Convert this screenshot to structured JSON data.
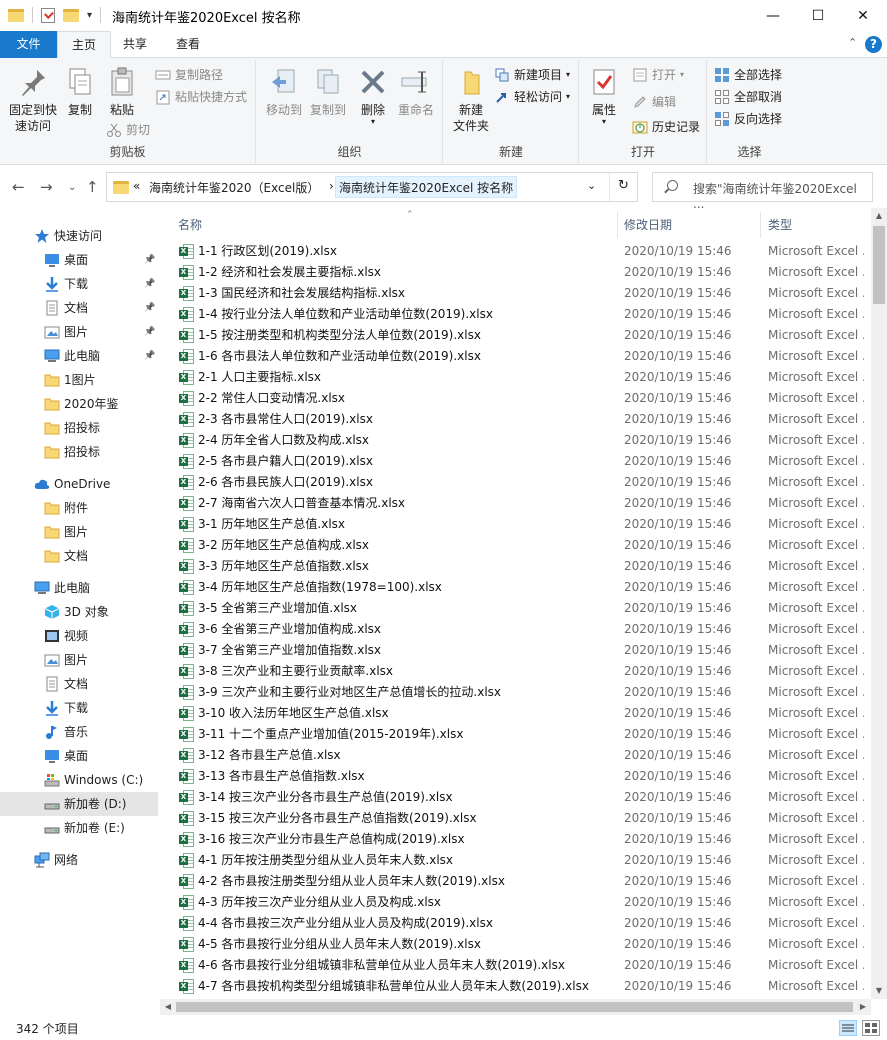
{
  "window": {
    "title": "海南统计年鉴2020Excel 按名称",
    "minimize": "—",
    "maximize": "☐",
    "close": "✕"
  },
  "ribbon_tabs": [
    {
      "label": "文件"
    },
    {
      "label": "主页"
    },
    {
      "label": "共享"
    },
    {
      "label": "查看"
    }
  ],
  "ribbon": {
    "clipboard": {
      "label": "剪贴板",
      "pin": "固定到快\n速访问",
      "copy": "复制",
      "paste": "粘贴",
      "copy_path": "复制路径",
      "paste_shortcut": "粘贴快捷方式",
      "cut": "剪切"
    },
    "organize": {
      "label": "组织",
      "move_to": "移动到",
      "copy_to": "复制到",
      "delete": "删除",
      "rename": "重命名"
    },
    "new": {
      "label": "新建",
      "new_folder": "新建\n文件夹",
      "new_item": "新建项目",
      "easy_access": "轻松访问"
    },
    "open": {
      "label": "打开",
      "properties": "属性",
      "open": "打开",
      "edit": "编辑",
      "history": "历史记录"
    },
    "select": {
      "label": "选择",
      "select_all": "全部选择",
      "select_none": "全部取消",
      "invert": "反向选择"
    }
  },
  "address": {
    "prefix": "«",
    "parent": "海南统计年鉴2020（Excel版）",
    "current": "海南统计年鉴2020Excel 按名称",
    "search_placeholder": "搜索\"海南统计年鉴2020Excel ..."
  },
  "sidebar": {
    "items": [
      {
        "label": "快速访问",
        "icon": "star-icon"
      },
      {
        "label": "桌面",
        "icon": "desktop-icon",
        "pinned": true
      },
      {
        "label": "下载",
        "icon": "download-icon",
        "pinned": true
      },
      {
        "label": "文档",
        "icon": "document-icon",
        "pinned": true
      },
      {
        "label": "图片",
        "icon": "pictures-icon",
        "pinned": true
      },
      {
        "label": "此电脑",
        "icon": "computer-icon",
        "pinned": true
      },
      {
        "label": "1图片",
        "icon": "folder-icon"
      },
      {
        "label": "2020年鉴",
        "icon": "folder-icon"
      },
      {
        "label": "招投标",
        "icon": "folder-icon"
      },
      {
        "label": "招投标",
        "icon": "folder-icon"
      },
      {
        "label": "OneDrive",
        "icon": "cloud-icon"
      },
      {
        "label": "附件",
        "icon": "folder-icon"
      },
      {
        "label": "图片",
        "icon": "folder-icon"
      },
      {
        "label": "文档",
        "icon": "folder-icon"
      },
      {
        "label": "此电脑",
        "icon": "computer-icon"
      },
      {
        "label": "3D 对象",
        "icon": "3d-objects-icon"
      },
      {
        "label": "视频",
        "icon": "video-icon"
      },
      {
        "label": "图片",
        "icon": "pictures-icon"
      },
      {
        "label": "文档",
        "icon": "document-icon"
      },
      {
        "label": "下载",
        "icon": "download-icon"
      },
      {
        "label": "音乐",
        "icon": "music-icon"
      },
      {
        "label": "桌面",
        "icon": "desktop-icon"
      },
      {
        "label": "Windows (C:)",
        "icon": "drive-c-icon"
      },
      {
        "label": "新加卷 (D:)",
        "icon": "drive-icon",
        "selected": true
      },
      {
        "label": "新加卷 (E:)",
        "icon": "drive-icon"
      },
      {
        "label": "网络",
        "icon": "network-icon"
      }
    ]
  },
  "columns": {
    "name": "名称",
    "date": "修改日期",
    "type": "类型"
  },
  "files": [
    {
      "name": "1-1 行政区划(2019).xlsx",
      "date": "2020/10/19 15:46",
      "type": "Microsoft Excel ..."
    },
    {
      "name": "1-2  经济和社会发展主要指标.xlsx",
      "date": "2020/10/19 15:46",
      "type": "Microsoft Excel ..."
    },
    {
      "name": "1-3  国民经济和社会发展结构指标.xlsx",
      "date": "2020/10/19 15:46",
      "type": "Microsoft Excel ..."
    },
    {
      "name": "1-4  按行业分法人单位数和产业活动单位数(2019).xlsx",
      "date": "2020/10/19 15:46",
      "type": "Microsoft Excel ..."
    },
    {
      "name": "1-5  按注册类型和机构类型分法人单位数(2019).xlsx",
      "date": "2020/10/19 15:46",
      "type": "Microsoft Excel ..."
    },
    {
      "name": "1-6  各市县法人单位数和产业活动单位数(2019).xlsx",
      "date": "2020/10/19 15:46",
      "type": "Microsoft Excel ..."
    },
    {
      "name": "2-1  人口主要指标.xlsx",
      "date": "2020/10/19 15:46",
      "type": "Microsoft Excel ..."
    },
    {
      "name": "2-2  常住人口变动情况.xlsx",
      "date": "2020/10/19 15:46",
      "type": "Microsoft Excel ..."
    },
    {
      "name": "2-3  各市县常住人口(2019).xlsx",
      "date": "2020/10/19 15:46",
      "type": "Microsoft Excel ..."
    },
    {
      "name": "2-4  历年全省人口数及构成.xlsx",
      "date": "2020/10/19 15:46",
      "type": "Microsoft Excel ..."
    },
    {
      "name": "2-5  各市县户籍人口(2019).xlsx",
      "date": "2020/10/19 15:46",
      "type": "Microsoft Excel ..."
    },
    {
      "name": "2-6  各市县民族人口(2019).xlsx",
      "date": "2020/10/19 15:46",
      "type": "Microsoft Excel ..."
    },
    {
      "name": "2-7  海南省六次人口普查基本情况.xlsx",
      "date": "2020/10/19 15:46",
      "type": "Microsoft Excel ..."
    },
    {
      "name": "3-1  历年地区生产总值.xlsx",
      "date": "2020/10/19 15:46",
      "type": "Microsoft Excel ..."
    },
    {
      "name": "3-2  历年地区生产总值构成.xlsx",
      "date": "2020/10/19 15:46",
      "type": "Microsoft Excel ..."
    },
    {
      "name": "3-3 历年地区生产总值指数.xlsx",
      "date": "2020/10/19 15:46",
      "type": "Microsoft Excel ..."
    },
    {
      "name": "3-4 历年地区生产总值指数(1978=100).xlsx",
      "date": "2020/10/19 15:46",
      "type": "Microsoft Excel ..."
    },
    {
      "name": "3-5 全省第三产业增加值.xlsx",
      "date": "2020/10/19 15:46",
      "type": "Microsoft Excel ..."
    },
    {
      "name": "3-6 全省第三产业增加值构成.xlsx",
      "date": "2020/10/19 15:46",
      "type": "Microsoft Excel ..."
    },
    {
      "name": "3-7 全省第三产业增加值指数.xlsx",
      "date": "2020/10/19 15:46",
      "type": "Microsoft Excel ..."
    },
    {
      "name": "3-8 三次产业和主要行业贡献率.xlsx",
      "date": "2020/10/19 15:46",
      "type": "Microsoft Excel ..."
    },
    {
      "name": "3-9 三次产业和主要行业对地区生产总值增长的拉动.xlsx",
      "date": "2020/10/19 15:46",
      "type": "Microsoft Excel ..."
    },
    {
      "name": "3-10 收入法历年地区生产总值.xlsx",
      "date": "2020/10/19 15:46",
      "type": "Microsoft Excel ..."
    },
    {
      "name": "3-11 十二个重点产业增加值(2015-2019年).xlsx",
      "date": "2020/10/19 15:46",
      "type": "Microsoft Excel ..."
    },
    {
      "name": "3-12 各市县生产总值.xlsx",
      "date": "2020/10/19 15:46",
      "type": "Microsoft Excel ..."
    },
    {
      "name": "3-13  各市县生产总值指数.xlsx",
      "date": "2020/10/19 15:46",
      "type": "Microsoft Excel ..."
    },
    {
      "name": "3-14  按三次产业分各市县生产总值(2019).xlsx",
      "date": "2020/10/19 15:46",
      "type": "Microsoft Excel ..."
    },
    {
      "name": "3-15  按三次产业分各市县生产总值指数(2019).xlsx",
      "date": "2020/10/19 15:46",
      "type": "Microsoft Excel ..."
    },
    {
      "name": "3-16  按三次产业分市县生产总值构成(2019).xlsx",
      "date": "2020/10/19 15:46",
      "type": "Microsoft Excel ..."
    },
    {
      "name": "4-1  历年按注册类型分组从业人员年末人数.xlsx",
      "date": "2020/10/19 15:46",
      "type": "Microsoft Excel ..."
    },
    {
      "name": "4-2  各市县按注册类型分组从业人员年末人数(2019).xlsx",
      "date": "2020/10/19 15:46",
      "type": "Microsoft Excel ..."
    },
    {
      "name": "4-3  历年按三次产业分组从业人员及构成.xlsx",
      "date": "2020/10/19 15:46",
      "type": "Microsoft Excel ..."
    },
    {
      "name": "4-4  各市县按三次产业分组从业人员及构成(2019).xlsx",
      "date": "2020/10/19 15:46",
      "type": "Microsoft Excel ..."
    },
    {
      "name": "4-5  各市县按行业分组从业人员年末人数(2019).xlsx",
      "date": "2020/10/19 15:46",
      "type": "Microsoft Excel ..."
    },
    {
      "name": "4-6  各市县按行业分组城镇非私营单位从业人员年末人数(2019).xlsx",
      "date": "2020/10/19 15:46",
      "type": "Microsoft Excel ..."
    },
    {
      "name": "4-7  各市县按机构类型分组城镇非私营单位从业人员年末人数(2019).xlsx",
      "date": "2020/10/19 15:46",
      "type": "Microsoft Excel ..."
    }
  ],
  "status": {
    "count": "342 个项目"
  },
  "colors": {
    "accent": "#1979ca",
    "excel_green": "#1d7044",
    "folder": "#f8d775"
  }
}
